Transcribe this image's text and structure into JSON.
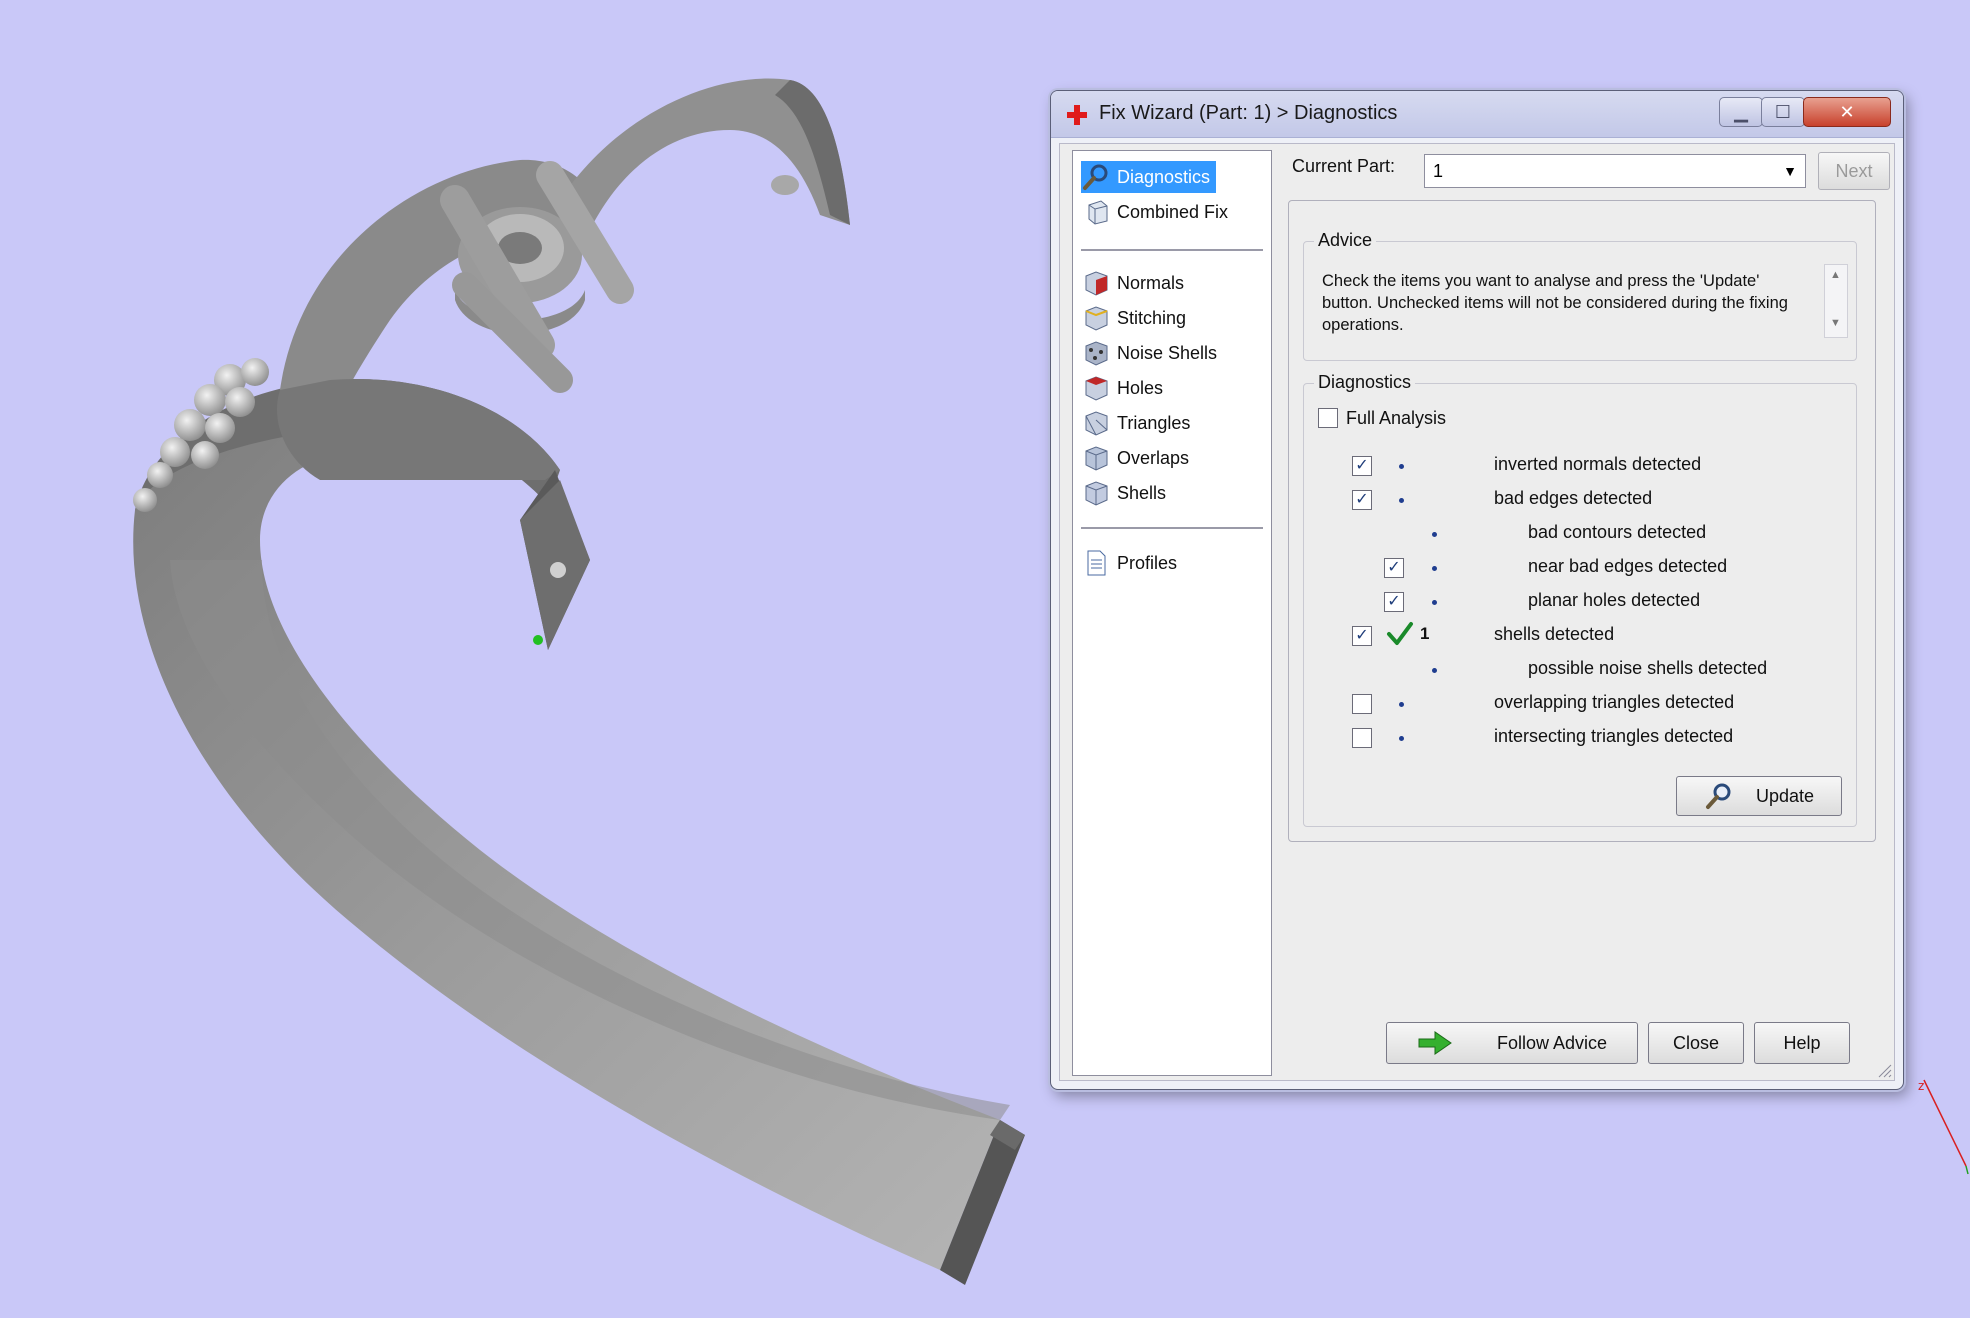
{
  "window": {
    "title": "Fix Wizard (Part: 1) > Diagnostics",
    "minimize_glyph": "▁",
    "maximize_glyph": "☐",
    "close_glyph": "✕"
  },
  "nav": {
    "items": [
      {
        "label": "Diagnostics",
        "icon": "magnifier-icon"
      },
      {
        "label": "Combined Fix",
        "icon": "cube-icon"
      },
      {
        "label": "Normals",
        "icon": "cube-red-face-icon"
      },
      {
        "label": "Stitching",
        "icon": "cube-stitching-icon"
      },
      {
        "label": "Noise Shells",
        "icon": "cube-noise-icon"
      },
      {
        "label": "Holes",
        "icon": "cube-holes-icon"
      },
      {
        "label": "Triangles",
        "icon": "cube-triangles-icon"
      },
      {
        "label": "Overlaps",
        "icon": "cube-overlaps-icon"
      },
      {
        "label": "Shells",
        "icon": "cube-shells-icon"
      },
      {
        "label": "Profiles",
        "icon": "document-icon"
      }
    ],
    "selected": "Diagnostics"
  },
  "current_part": {
    "label": "Current Part:",
    "value": "1",
    "next_label": "Next"
  },
  "advice": {
    "title": "Advice",
    "text": "Check the items you want to analyse and press the 'Update' button. Unchecked items will not be considered during the fixing operations."
  },
  "diagnostics": {
    "title": "Diagnostics",
    "full_analysis_label": "Full Analysis",
    "full_analysis_checked": false,
    "rows": [
      {
        "label": "inverted normals detected",
        "checked": true,
        "indent": 0,
        "has_checkbox": true,
        "count": ""
      },
      {
        "label": "bad edges detected",
        "checked": true,
        "indent": 0,
        "has_checkbox": true,
        "count": ""
      },
      {
        "label": "bad contours detected",
        "checked": false,
        "indent": 1,
        "has_checkbox": false,
        "count": ""
      },
      {
        "label": "near bad edges detected",
        "checked": true,
        "indent": 1,
        "has_checkbox": true,
        "count": ""
      },
      {
        "label": "planar holes detected",
        "checked": true,
        "indent": 1,
        "has_checkbox": true,
        "count": ""
      },
      {
        "label": "shells detected",
        "checked": true,
        "indent": 0,
        "has_checkbox": true,
        "count": "1",
        "status": "ok"
      },
      {
        "label": "possible noise shells detected",
        "checked": false,
        "indent": 1,
        "has_checkbox": false,
        "count": ""
      },
      {
        "label": "overlapping triangles detected",
        "checked": false,
        "indent": 0,
        "has_checkbox": true,
        "count": ""
      },
      {
        "label": "intersecting triangles detected",
        "checked": false,
        "indent": 0,
        "has_checkbox": true,
        "count": ""
      }
    ],
    "update_label": "Update"
  },
  "footer": {
    "follow_advice_label": "Follow Advice",
    "close_label": "Close",
    "help_label": "Help"
  },
  "colors": {
    "background": "#c9c8f8",
    "selection": "#3399ff",
    "check_ok": "#1a8a2a",
    "arrow_green": "#35b02f"
  }
}
